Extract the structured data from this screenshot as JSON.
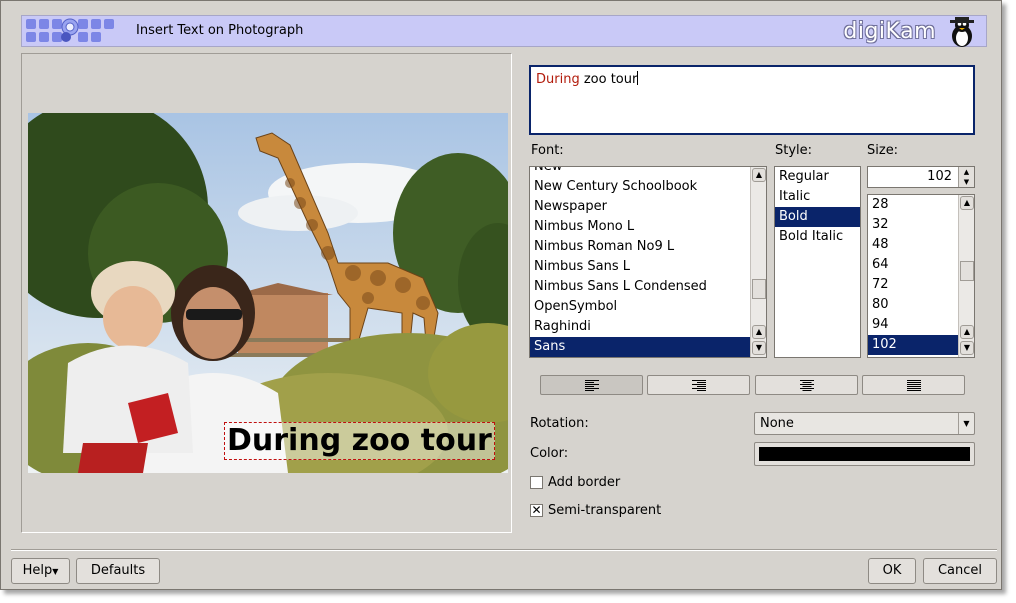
{
  "window": {
    "title": "Insert Text on Photograph",
    "brand": "digiKam"
  },
  "text_input": {
    "word1": "During",
    "rest": " zoo tour"
  },
  "caption_overlay": "During zoo tour",
  "font": {
    "label": "Font:",
    "items": [
      "New",
      "New Century Schoolbook",
      "Newspaper",
      "Nimbus Mono L",
      "Nimbus Roman No9 L",
      "Nimbus Sans L",
      "Nimbus Sans L Condensed",
      "OpenSymbol",
      "Raghindi",
      "Sans"
    ],
    "selected": "Sans"
  },
  "style": {
    "label": "Style:",
    "items": [
      "Regular",
      "Italic",
      "Bold",
      "Bold Italic"
    ],
    "selected": "Bold"
  },
  "size": {
    "label": "Size:",
    "value": "102",
    "items": [
      "28",
      "32",
      "48",
      "64",
      "72",
      "80",
      "94",
      "102"
    ],
    "selected": "102"
  },
  "alignment": {
    "buttons": [
      "align-left-icon",
      "align-right-icon",
      "align-center-icon",
      "align-justify-icon"
    ],
    "active": "align-left-icon"
  },
  "rotation": {
    "label": "Rotation:",
    "value": "None"
  },
  "color": {
    "label": "Color:",
    "value": "#000000"
  },
  "options": {
    "add_border": {
      "label": "Add border",
      "checked": false
    },
    "semi_transparent": {
      "label": "Semi-transparent",
      "checked": true
    }
  },
  "buttons": {
    "help": "Help",
    "defaults": "Defaults",
    "ok": "OK",
    "cancel": "Cancel"
  },
  "colors": {
    "selection": "#0a246a",
    "banner": "#c9c9f7",
    "dialog_bg": "#d6d3ce"
  }
}
